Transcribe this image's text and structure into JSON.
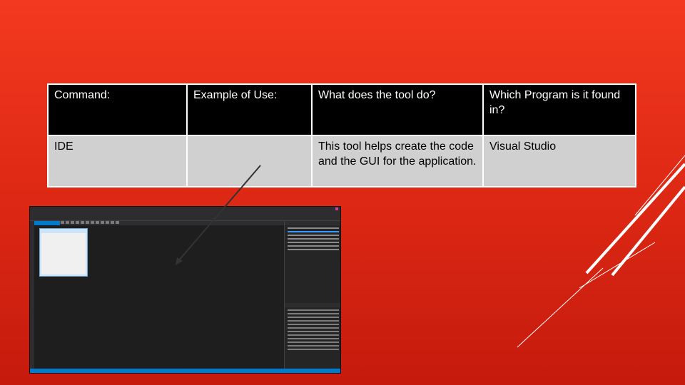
{
  "table": {
    "headers": [
      "Command:",
      "Example of Use:",
      "What does the tool do?",
      "Which Program is it found in?"
    ],
    "row": {
      "command": "IDE",
      "example": "",
      "description": "This tool helps create the code and the GUI for the application.",
      "program": "Visual Studio"
    }
  },
  "colors": {
    "background": "#e02a15",
    "header_bg": "#000000",
    "row_bg": "#d0d0d0",
    "ide_accent": "#007acc"
  }
}
